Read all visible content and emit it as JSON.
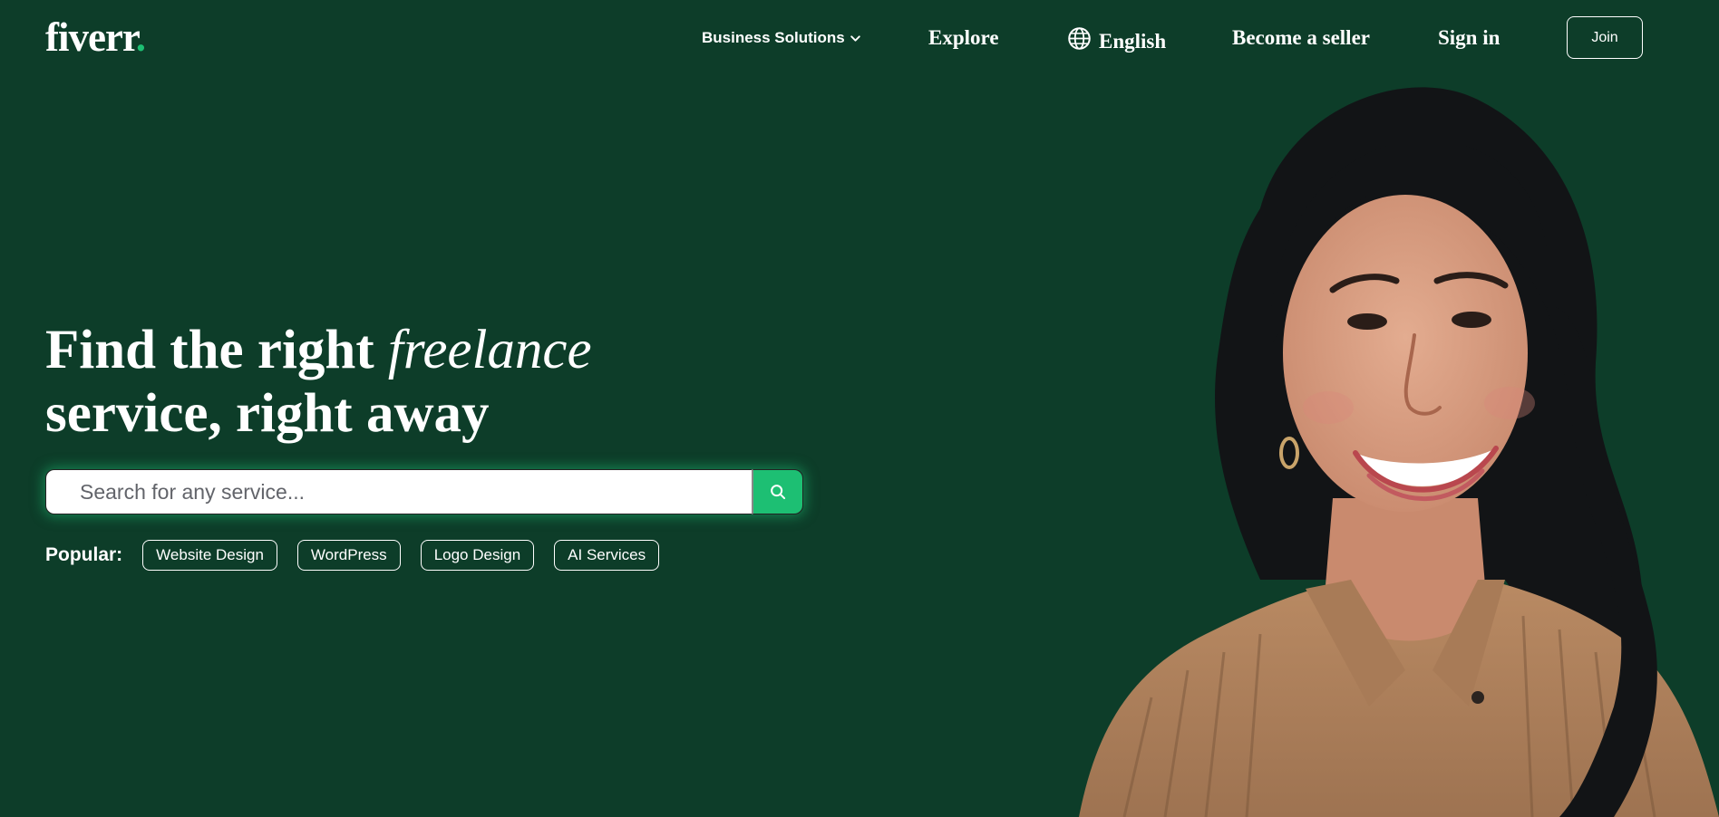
{
  "header": {
    "logo_text": "fiverr",
    "logo_dot": ".",
    "nav": {
      "business_solutions": "Business Solutions",
      "explore": "Explore",
      "language": "English",
      "become_seller": "Become a seller",
      "sign_in": "Sign in",
      "join": "Join"
    }
  },
  "hero": {
    "headline_part1": "Find the right ",
    "headline_italic": "freelance",
    "headline_line2": "service, right away",
    "search": {
      "placeholder": "Search for any service..."
    },
    "popular": {
      "label": "Popular:",
      "items": [
        "Website Design",
        "WordPress",
        "Logo Design",
        "AI Services"
      ]
    }
  },
  "colors": {
    "background": "#0d3d29",
    "accent": "#1dbf73",
    "text": "#ffffff"
  },
  "icons": {
    "nav_dropdown": "chevron-down-icon",
    "language": "globe-icon",
    "search": "search-icon"
  }
}
